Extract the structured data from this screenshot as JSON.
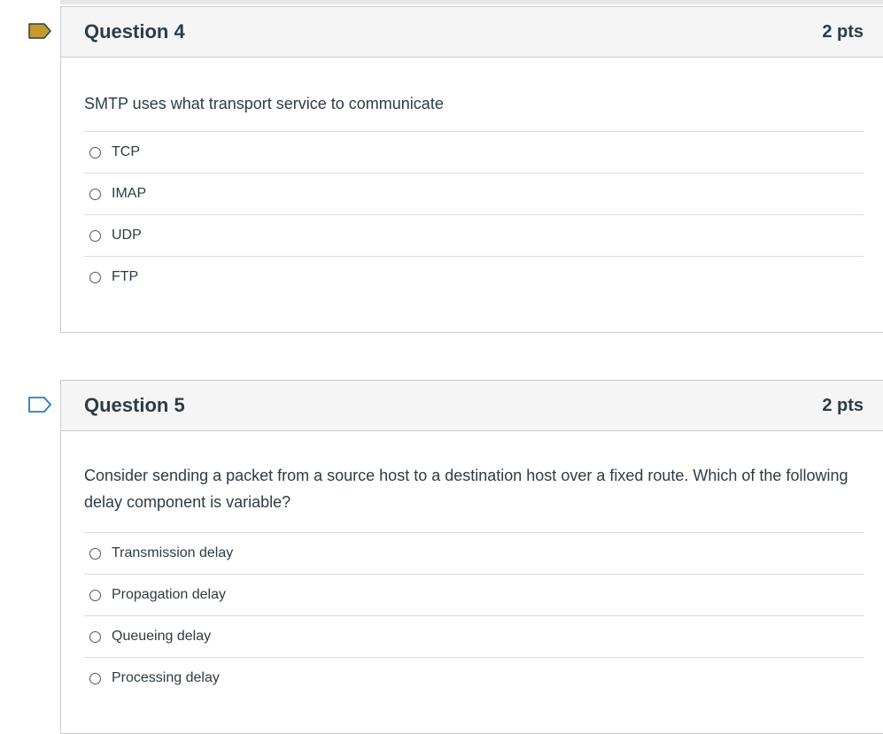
{
  "colors": {
    "flag_marked": "#c39b2c",
    "flag_unmarked": "#2b7abc"
  },
  "questions": [
    {
      "title": "Question 4",
      "points": "2 pts",
      "flagged": true,
      "text": "SMTP uses what transport service to communicate",
      "answers": [
        "TCP",
        "IMAP",
        "UDP",
        "FTP"
      ]
    },
    {
      "title": "Question 5",
      "points": "2 pts",
      "flagged": false,
      "text": "Consider sending a packet from a source host to a destination host over a fixed route. Which of the following delay component is variable?",
      "answers": [
        "Transmission delay",
        "Propagation delay",
        "Queueing delay",
        "Processing delay"
      ]
    }
  ]
}
